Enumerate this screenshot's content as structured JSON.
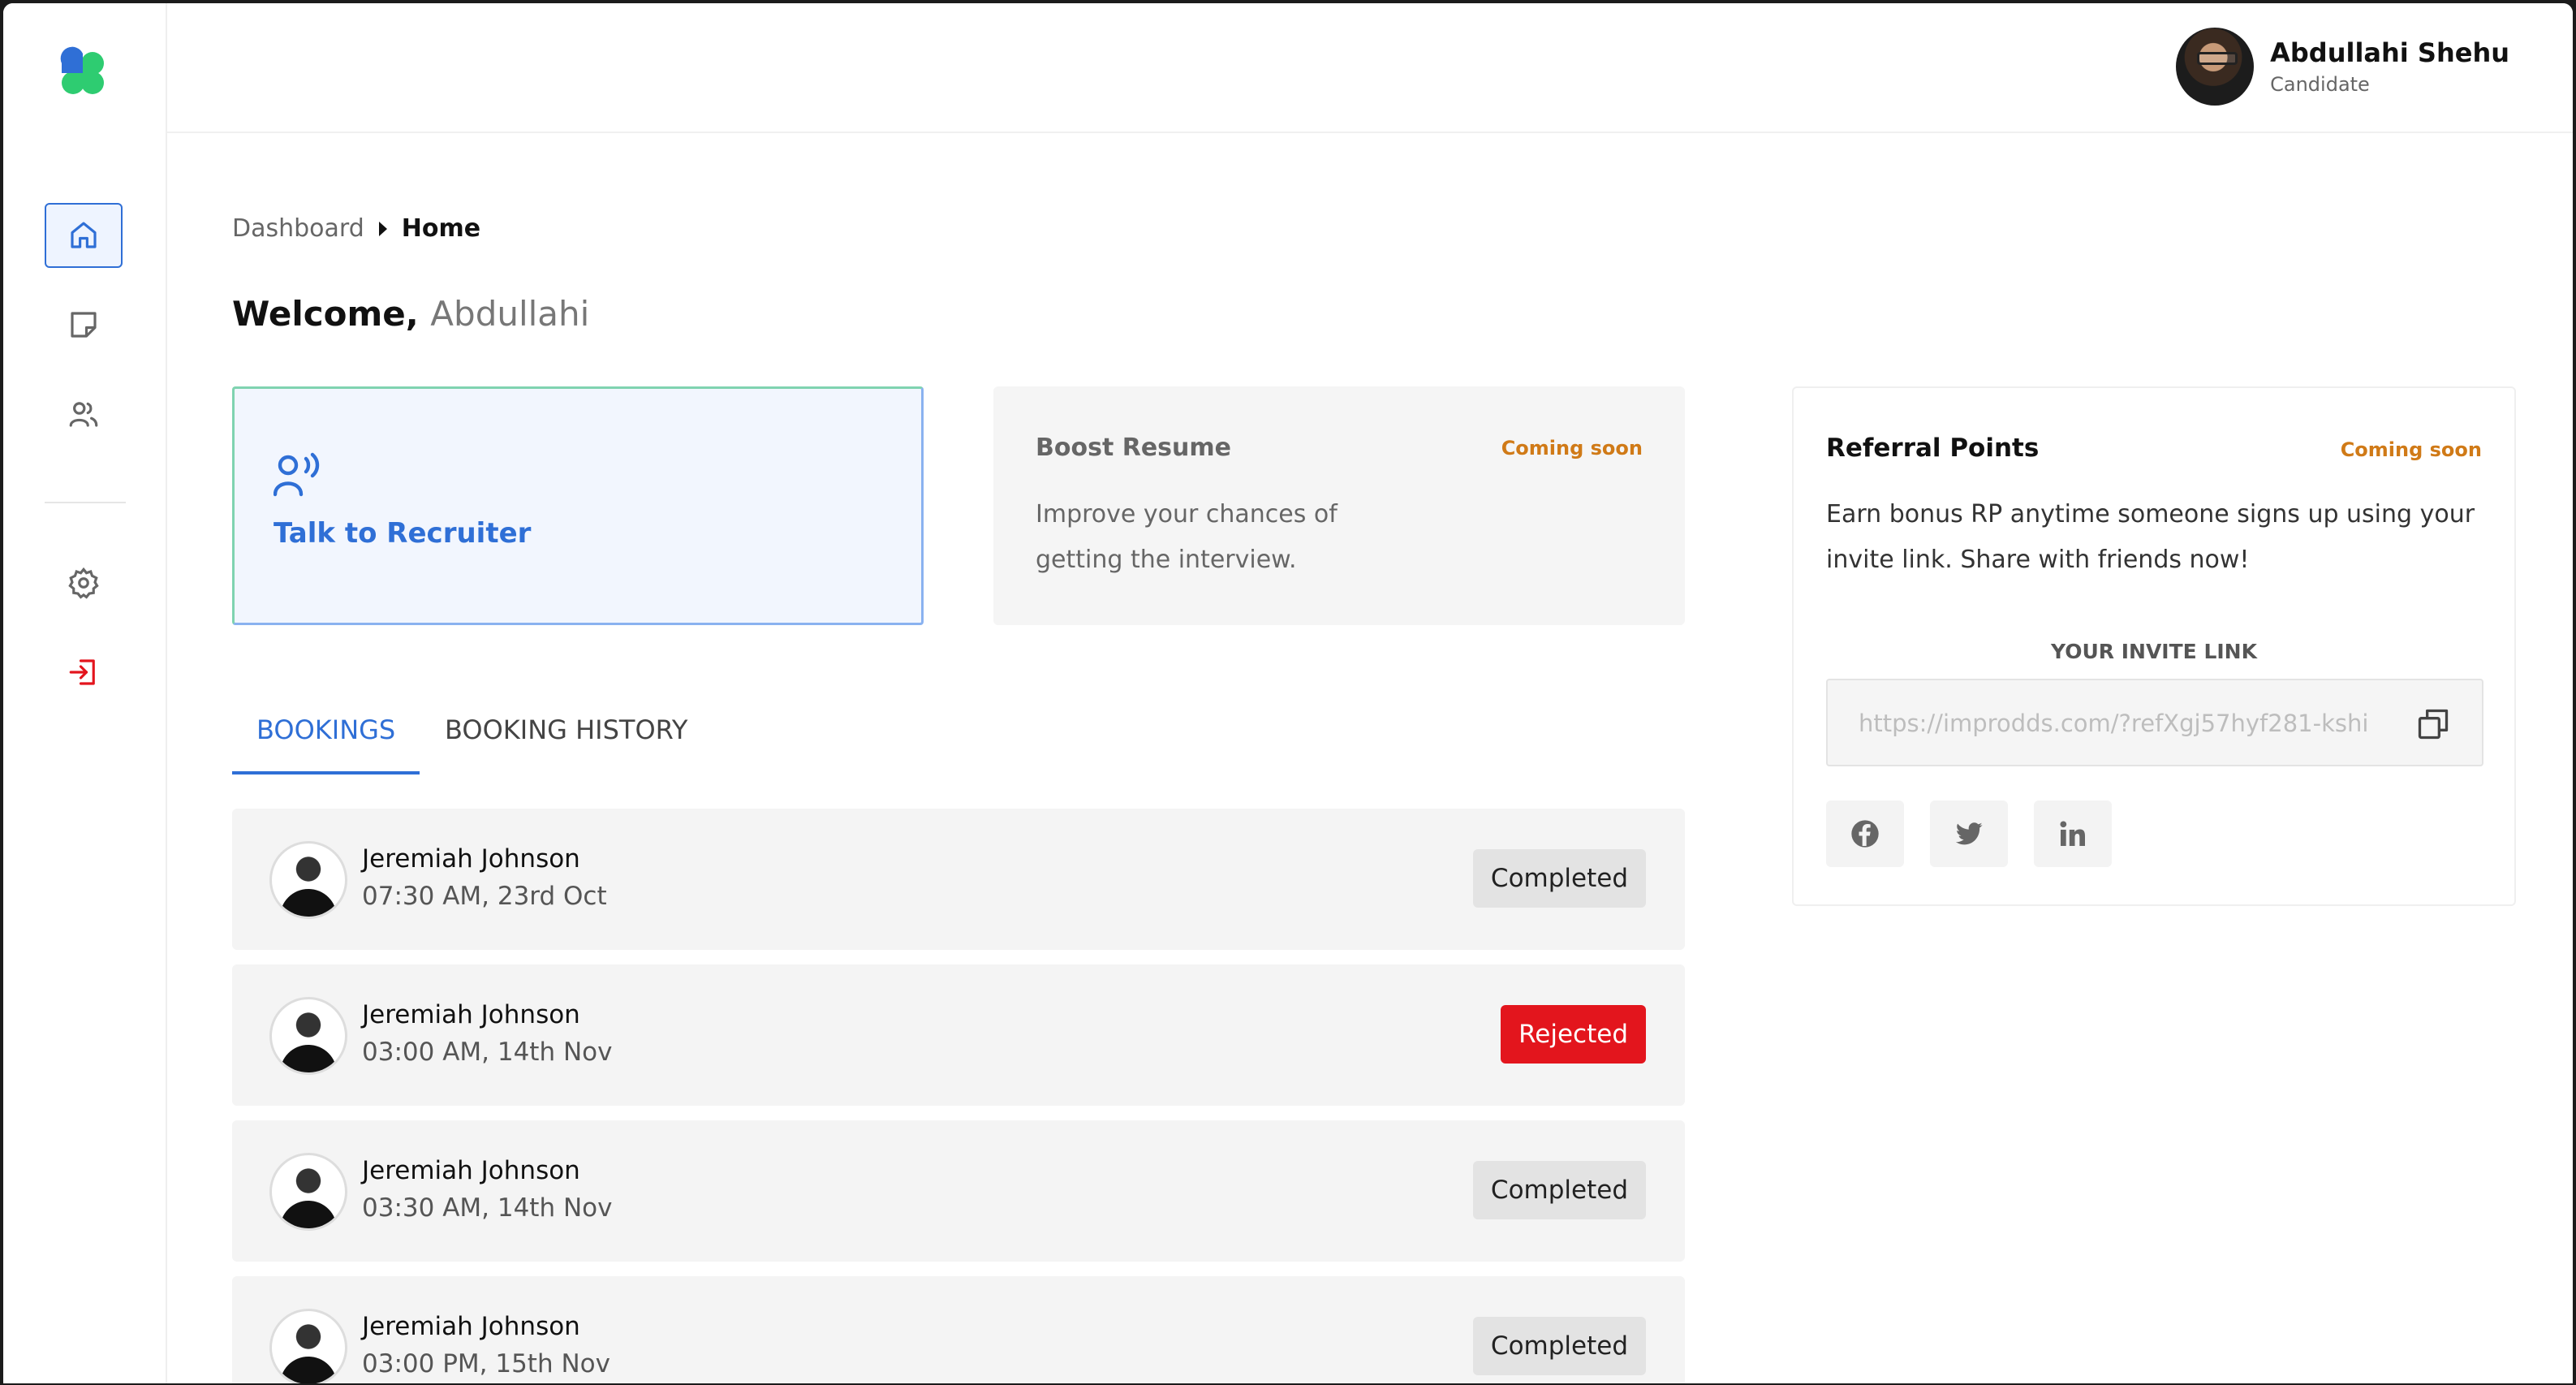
{
  "user": {
    "name": "Abdullahi Shehu",
    "role": "Candidate"
  },
  "sidebar": {
    "items": [
      {
        "icon": "home-icon",
        "active": true
      },
      {
        "icon": "note-icon",
        "active": false
      },
      {
        "icon": "users-icon",
        "active": false
      },
      {
        "icon": "gear-icon",
        "active": false
      },
      {
        "icon": "logout-icon",
        "active": false
      }
    ]
  },
  "breadcrumb": {
    "parent": "Dashboard",
    "current": "Home"
  },
  "welcome": {
    "greeting": "Welcome,",
    "first_name": "Abdullahi"
  },
  "cards": {
    "talk": {
      "label": "Talk to Recruiter"
    },
    "boost": {
      "title": "Boost Resume",
      "badge": "Coming soon",
      "description": "Improve your chances of getting the interview."
    }
  },
  "tabs": [
    {
      "label": "BOOKINGS",
      "active": true
    },
    {
      "label": "BOOKING HISTORY",
      "active": false
    }
  ],
  "bookings": [
    {
      "name": "Jeremiah Johnson",
      "time": "07:30 AM, 23rd Oct",
      "status": "Completed"
    },
    {
      "name": "Jeremiah Johnson",
      "time": "03:00 AM, 14th Nov",
      "status": "Rejected"
    },
    {
      "name": "Jeremiah Johnson",
      "time": "03:30 AM, 14th Nov",
      "status": "Completed"
    },
    {
      "name": "Jeremiah Johnson",
      "time": "03:00 PM, 15th Nov",
      "status": "Completed"
    }
  ],
  "referral": {
    "title": "Referral Points",
    "badge": "Coming soon",
    "description": "Earn bonus RP anytime someone signs up using your invite link. Share with friends now!",
    "invite_label": "YOUR INVITE LINK",
    "invite_link": "https://improdds.com/?refXgj57hyf281-kshi",
    "socials": [
      "facebook-icon",
      "twitter-icon",
      "linkedin-icon"
    ]
  },
  "colors": {
    "accent": "#2f6fd6",
    "coming_soon": "#d07a17",
    "rejected": "#e3151d",
    "completed_bg": "#e3e3e3"
  }
}
